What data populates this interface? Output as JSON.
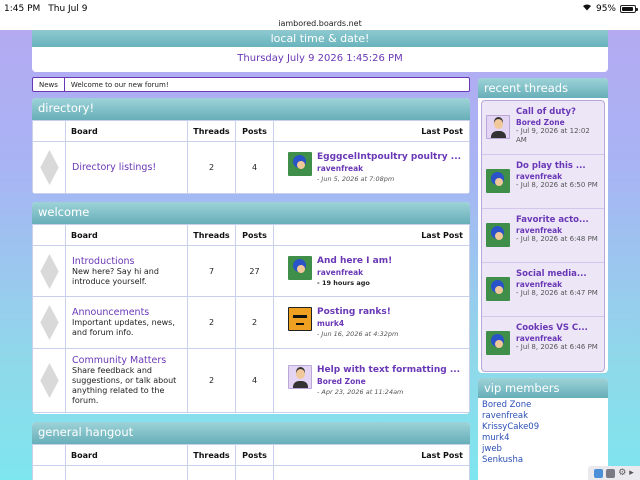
{
  "status": {
    "time": "1:45 PM",
    "date": "Thu Jul 9",
    "battery": "95%",
    "battery_level": 0.95
  },
  "url": "iambored.boards.net",
  "timebox": {
    "title": "local time & date!",
    "value": "Thursday July 9 2026 1:45:26 PM"
  },
  "news": {
    "tag": "News",
    "message": "Welcome to our new forum!"
  },
  "headers": {
    "board": "Board",
    "threads": "Threads",
    "posts": "Posts",
    "last_post": "Last Post"
  },
  "categories": [
    {
      "title": "directory!",
      "boards": [
        {
          "name": "Directory listings!",
          "desc": "",
          "threads": "2",
          "posts": "4",
          "lp_title": "EgggcelIntpoultry poultry ...",
          "lp_user": "ravenfreak",
          "lp_date": "Jun 5, 2026 at 7:08pm",
          "lp_avatar": "sonic"
        }
      ]
    },
    {
      "title": "welcome",
      "boards": [
        {
          "name": "Introductions",
          "desc": "New here? Say hi and introduce yourself.",
          "threads": "7",
          "posts": "27",
          "lp_title": "And here I am!",
          "lp_user": "ravenfreak",
          "lp_date": "19 hours ago",
          "lp_avatar": "sonic"
        },
        {
          "name": "Announcements",
          "desc": "Important updates, news, and forum info.",
          "threads": "2",
          "posts": "2",
          "lp_title": "Posting ranks!",
          "lp_user": "murk4",
          "lp_date": "Jun 16, 2026 at 4:32pm",
          "lp_avatar": "face"
        },
        {
          "name": "Community Matters",
          "desc": "Share feedback and suggestions, or talk about anything related to the forum.",
          "threads": "2",
          "posts": "4",
          "lp_title": "Help with text formatting ...",
          "lp_user": "Bored Zone",
          "lp_date": "Apr 23, 2026 at 11:24am",
          "lp_avatar": "person"
        }
      ]
    },
    {
      "title": "general hangout",
      "boards": []
    }
  ],
  "recent": {
    "title": "recent threads",
    "items": [
      {
        "title": "Call of duty?",
        "user": "Bored Zone",
        "date": "- Jul 9, 2026 at 12:02 AM",
        "avatar": "person"
      },
      {
        "title": "Do play this ...",
        "user": "ravenfreak",
        "date": "- Jul 8, 2026 at 6:50 PM",
        "avatar": "sonic"
      },
      {
        "title": "Favorite acto...",
        "user": "ravenfreak",
        "date": "- Jul 8, 2026 at 6:48 PM",
        "avatar": "sonic"
      },
      {
        "title": "Social media...",
        "user": "ravenfreak",
        "date": "- Jul 8, 2026 at 6:47 PM",
        "avatar": "sonic"
      },
      {
        "title": "Cookies VS C...",
        "user": "ravenfreak",
        "date": "- Jul 8, 2026 at 6:46 PM",
        "avatar": "sonic"
      }
    ]
  },
  "vip": {
    "title": "vip members",
    "members": [
      "Bored Zone",
      "ravenfreak",
      "KrissyCake09",
      "murk4",
      "jweb",
      "Senkusha"
    ]
  },
  "colors": {
    "accent": "#6a38b6",
    "header_teal": "#67aeb8",
    "link_blue": "#2b4fb5"
  }
}
